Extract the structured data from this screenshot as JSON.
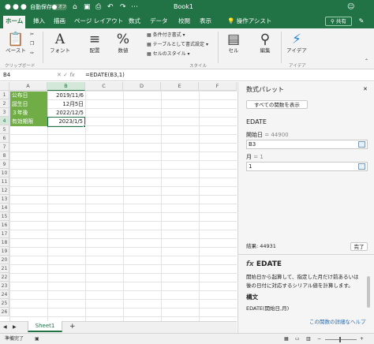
{
  "titlebar": {
    "autosave_label": "自動保存",
    "autosave_state": "オフ",
    "title": "Book1"
  },
  "tabs": [
    "ホーム",
    "挿入",
    "描画",
    "ページ レイアウト",
    "数式",
    "データ",
    "校閲",
    "表示",
    "操作アシスト"
  ],
  "share_label": "共有",
  "ribbon": {
    "paste": "ペースト",
    "clipboard_group": "クリップボード",
    "font": "フォント",
    "align": "配置",
    "number": "数値",
    "cond": "条件付き書式",
    "table": "テーブルとして書式設定",
    "cellstyle": "セルのスタイル",
    "style_group": "スタイル",
    "cell": "セル",
    "edit": "編集",
    "ideas": "アイデア",
    "ideas_group": "アイデア"
  },
  "formula_bar": {
    "name_box": "B4",
    "fx": "fx",
    "formula": "=EDATE(B3,1)"
  },
  "columns": [
    "A",
    "B",
    "C",
    "D",
    "E",
    "F"
  ],
  "rows": [
    "1",
    "2",
    "3",
    "4",
    "5",
    "6",
    "7",
    "8",
    "9",
    "10",
    "11",
    "12",
    "13",
    "14",
    "15",
    "16",
    "17",
    "18",
    "19",
    "20",
    "21",
    "22",
    "23",
    "24",
    "25",
    "26"
  ],
  "cells": [
    {
      "label": "公布日",
      "value": "2019/11/6"
    },
    {
      "label": "誕生日",
      "value": "12月5日"
    },
    {
      "label": "３年後",
      "value": "2022/12/5"
    },
    {
      "label": "有効期限",
      "value": "2023/1/5"
    }
  ],
  "sheet_tab": "Sheet1",
  "add_sheet": "+",
  "status": "準備完了",
  "pane": {
    "title": "数式パレット",
    "show_all": "すべての関数を表示",
    "func": "EDATE",
    "arg1_label": "開始日",
    "arg1_eq": "=",
    "arg1_val": "44900",
    "arg1_input": "B3",
    "arg2_label": "月",
    "arg2_eq": "=",
    "arg2_val": "1",
    "arg2_input": "1",
    "result": "結果: 44931",
    "done": "完了",
    "help_fx": "fx",
    "help_title": "EDATE",
    "help_desc1": "開始日から起算して、指定した月だけ前あるいは",
    "help_desc2": "後の日付に対応するシリアル値を計算します。",
    "syntax_h": "構文",
    "syntax": "EDATE(開始日,月)",
    "help_link": "この関数の詳細なヘルプ"
  }
}
